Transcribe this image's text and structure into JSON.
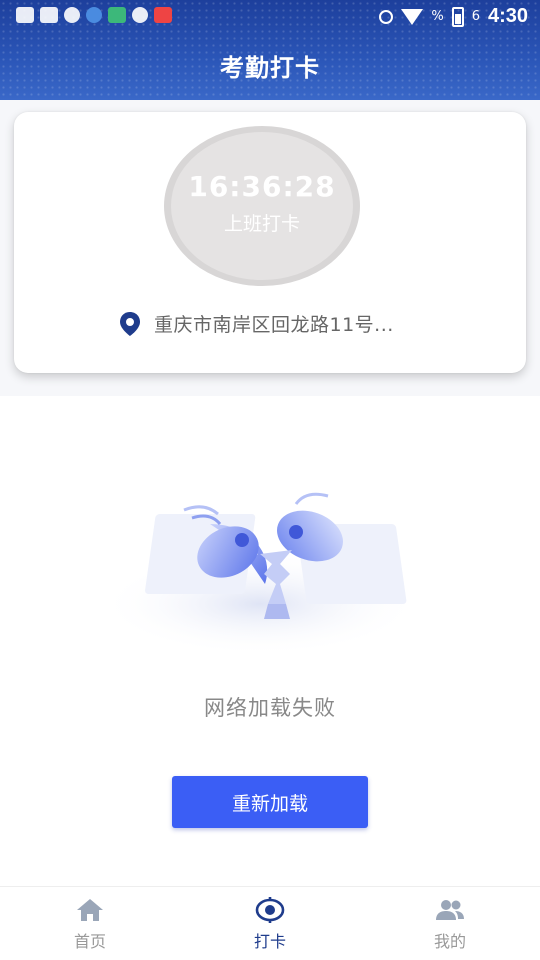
{
  "status_bar": {
    "time": "4:30",
    "battery_text": "6",
    "percent_text": "%"
  },
  "header": {
    "title": "考勤打卡"
  },
  "punch_card": {
    "time": "16:36:28",
    "label": "上班打卡",
    "location_icon": "location-pin-icon",
    "location": "重庆市南岸区回龙路11号..."
  },
  "error_state": {
    "illustration": "broken-satellite-dish",
    "message": "网络加载失败",
    "reload_label": "重新加载"
  },
  "bottom_nav": {
    "items": [
      {
        "label": "首页",
        "icon": "home-icon",
        "active": false
      },
      {
        "label": "打卡",
        "icon": "punch-target-icon",
        "active": true
      },
      {
        "label": "我的",
        "icon": "users-icon",
        "active": false
      }
    ]
  },
  "colors": {
    "header": "#2b56b8",
    "primary_button": "#3b5ef5",
    "nav_active": "#1f3c8c",
    "nav_inactive": "#9aa6b8"
  }
}
